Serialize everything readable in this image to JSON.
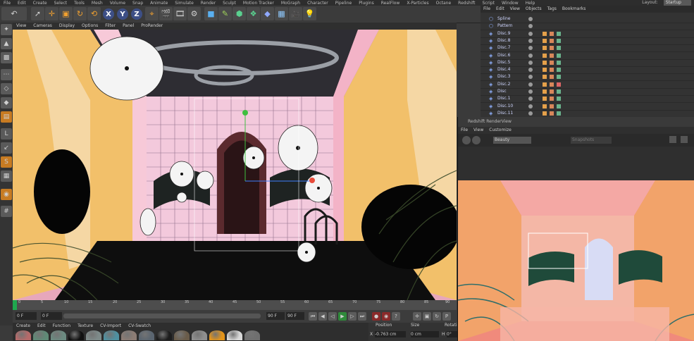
{
  "menubar": {
    "items": [
      "File",
      "Edit",
      "Create",
      "Select",
      "Tools",
      "Mesh",
      "Volume",
      "Snap",
      "Animate",
      "Simulate",
      "Render",
      "Sculpt",
      "Motion Tracker",
      "MoGraph",
      "Character",
      "Pipeline",
      "Plugins",
      "RealFlow",
      "X-Particles",
      "Octane",
      "Redshift",
      "Script",
      "Window",
      "Help"
    ],
    "layout_label": "Layout:",
    "layout_value": "Startup"
  },
  "toolbar": {
    "axes": [
      "X",
      "Y",
      "Z"
    ]
  },
  "viewport": {
    "menu": [
      "View",
      "Cameras",
      "Display",
      "Options",
      "Filter",
      "Panel",
      "ProRender"
    ]
  },
  "timeline": {
    "ticks": [
      "0",
      "5",
      "10",
      "15",
      "20",
      "25",
      "30",
      "35",
      "40",
      "45",
      "50",
      "55",
      "60",
      "65",
      "70",
      "75",
      "80",
      "85",
      "90"
    ],
    "current": "0 F"
  },
  "transport": {
    "start": "0 F",
    "field2": "0 F",
    "end": "90 F",
    "end2": "90 F"
  },
  "materials": {
    "menu": [
      "Create",
      "Edit",
      "Function",
      "Texture",
      "CV-Import",
      "CV-Swatch"
    ],
    "colors": [
      "#b56a6a",
      "#5f8a76",
      "#6b8a80",
      "#111111",
      "#7e8b8a",
      "#4f90a0",
      "#8c7c74",
      "#5a6570",
      "#1d1d1d",
      "#6a5c4a",
      "#8f8f8f",
      "#e3941a",
      "#d9d9d9",
      "#6f6f6f"
    ]
  },
  "coords": {
    "tabs": [
      "Position",
      "Size",
      "Rotation"
    ],
    "x_label": "X",
    "x_value": "-0.763 cm",
    "size_value": "0 cm",
    "h_label": "H",
    "h_value": "0°"
  },
  "object_manager": {
    "menu": [
      "File",
      "Edit",
      "View",
      "Objects",
      "Tags",
      "Bookmarks"
    ],
    "rows": [
      "Spline",
      "Pattern",
      "Disc.9",
      "Disc.8",
      "Disc.7",
      "Disc.6",
      "Disc.5",
      "Disc.4",
      "Disc.3",
      "Disc.2",
      "Disc",
      "Disc.1",
      "Disc.10",
      "Disc.11"
    ]
  },
  "render_view": {
    "title": "Redshift RenderView",
    "menu": [
      "File",
      "View",
      "Customize"
    ],
    "aov": "Beauty",
    "snapshots": "Snapshots"
  }
}
